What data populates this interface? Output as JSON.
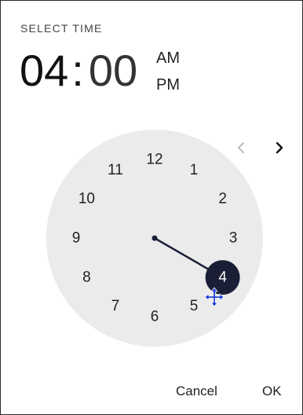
{
  "dialog": {
    "header_label": "SELECT TIME",
    "time": {
      "hours": "04",
      "separator": ":",
      "minutes": "00"
    },
    "ampm": {
      "am_label": "AM",
      "pm_label": "PM"
    },
    "clock": {
      "numbers": [
        "12",
        "1",
        "2",
        "3",
        "4",
        "5",
        "6",
        "7",
        "8",
        "9",
        "10",
        "11"
      ],
      "selected": "4",
      "face_color": "#ebebeb",
      "hand_color": "#1a1f36",
      "selected_color": "#1a1f36"
    },
    "nav": {
      "prev_icon": "chevron-left-icon",
      "next_icon": "chevron-right-icon"
    },
    "actions": {
      "cancel_label": "Cancel",
      "ok_label": "OK"
    },
    "cursor_icon": "move-cursor-icon"
  }
}
